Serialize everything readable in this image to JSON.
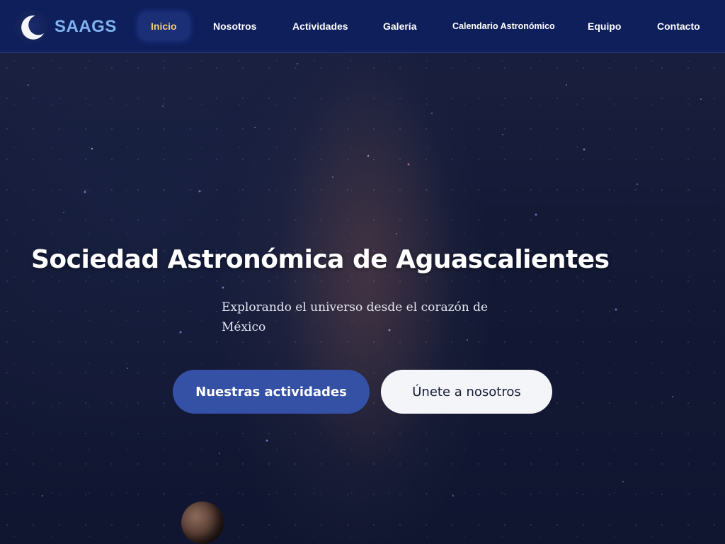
{
  "header": {
    "brand": "SAAGS",
    "logo_icon": "crescent-moon-icon",
    "nav": [
      {
        "label": "Inicio",
        "active": true
      },
      {
        "label": "Nosotros"
      },
      {
        "label": "Actividades"
      },
      {
        "label": "Galería"
      },
      {
        "label": "Calendario Astronómico"
      },
      {
        "label": "Equipo"
      },
      {
        "label": "Contacto"
      }
    ]
  },
  "hero": {
    "title": "Sociedad Astronómica de Aguascalientes",
    "subtitle": "Explorando el universo desde el corazón de México",
    "primary_button": "Nuestras actividades",
    "secondary_button": "Únete a nosotros"
  },
  "colors": {
    "navbar": "#0f1f5c",
    "brand": "#7fb4f0",
    "active_nav": "#f2d16b",
    "primary_button": "#3451a6",
    "secondary_button": "#f4f5f8"
  }
}
